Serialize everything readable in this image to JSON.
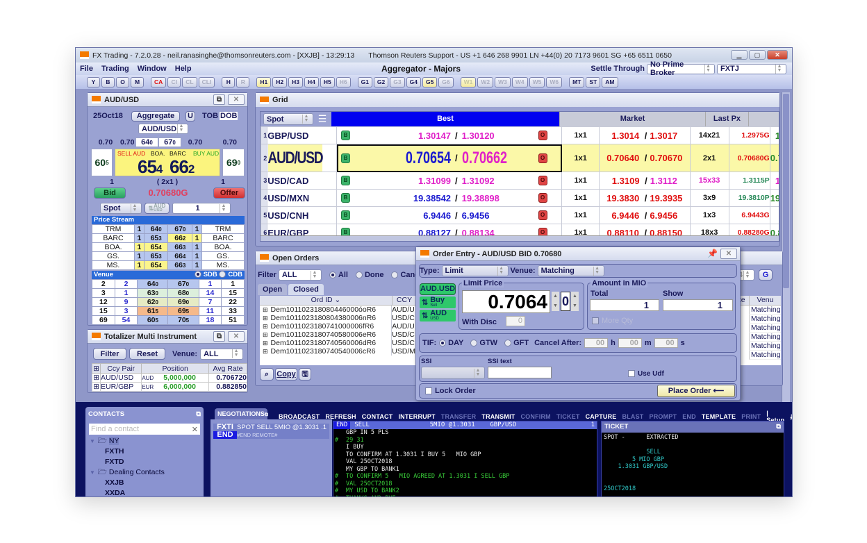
{
  "window": {
    "title": "FX Trading - 7.2.0.28 - neil.ranasinghe@thomsonreuters.com - [XXJB] - 13:29:13",
    "support": "Thomson Reuters Support - US +1 646 268 9901   LN +44(0) 20 7173 9601   SG +65 6511 0650",
    "app_title": "Aggregator - Majors"
  },
  "menu": [
    "File",
    "Trading",
    "Window",
    "Help"
  ],
  "settle": {
    "label": "Settle Through",
    "broker": "No Prime Broker",
    "account": "FXTJ"
  },
  "toolbar": [
    {
      "label": "Y",
      "state": ""
    },
    {
      "label": "B",
      "state": ""
    },
    {
      "label": "O",
      "state": ""
    },
    {
      "label": "M",
      "state": ""
    },
    {
      "sep": true
    },
    {
      "label": "CA",
      "state": "red"
    },
    {
      "label": "CI",
      "state": "dis"
    },
    {
      "label": "CL",
      "state": "dis"
    },
    {
      "label": "CLI",
      "state": "dis"
    },
    {
      "sep": true
    },
    {
      "label": "H",
      "state": ""
    },
    {
      "label": "R",
      "state": "dis"
    },
    {
      "sep": true
    },
    {
      "label": "H1",
      "state": "hl"
    },
    {
      "label": "H2",
      "state": ""
    },
    {
      "label": "H3",
      "state": ""
    },
    {
      "label": "H4",
      "state": ""
    },
    {
      "label": "H5",
      "state": ""
    },
    {
      "label": "H6",
      "state": "dis"
    },
    {
      "sep": true
    },
    {
      "label": "G1",
      "state": ""
    },
    {
      "label": "G2",
      "state": ""
    },
    {
      "label": "G3",
      "state": "dis"
    },
    {
      "label": "G4",
      "state": ""
    },
    {
      "label": "G5",
      "state": "hl"
    },
    {
      "label": "G6",
      "state": "dis"
    },
    {
      "sep": true
    },
    {
      "label": "W1",
      "state": "hl dis"
    },
    {
      "label": "W2",
      "state": "dis"
    },
    {
      "label": "W3",
      "state": "dis"
    },
    {
      "label": "W4",
      "state": "dis"
    },
    {
      "label": "W5",
      "state": "dis"
    },
    {
      "label": "W6",
      "state": "dis"
    },
    {
      "sep": true
    },
    {
      "label": "MT",
      "state": ""
    },
    {
      "label": "ST",
      "state": ""
    },
    {
      "label": "AM",
      "state": ""
    }
  ],
  "tile": {
    "title": "AUD/USD",
    "date": "25Oct18",
    "mode": "Aggregate",
    "u": "U",
    "tob": "TOB",
    "dob": "DOB",
    "pair": "AUD/USD",
    "big_l": "0.70",
    "big_l2": "0.70",
    "bid_top": "64",
    "bid_top_s": "0",
    "ask_top": "67",
    "ask_top_s": "0",
    "big_r": "0.70",
    "big_r2": "0.70",
    "side_bid": "60",
    "side_bid_s": "5",
    "side_ask": "69",
    "side_ask_s": "0",
    "sell_label": "SELL AUD",
    "sell_venue": "BOA.",
    "buy_venue": "BARC",
    "buy_label": "BUY AUD",
    "bid_big": "65",
    "bid_pip": "4",
    "ask_big": "66",
    "ask_pip": "2",
    "bid_qty": "1",
    "ratio": "( 2x1 )",
    "ask_qty": "1",
    "bid_btn": "Bid",
    "last": "0.70680G",
    "offer_btn": "Offer",
    "tenor": "Spot",
    "ccy_top": "AUD",
    "ccy_bot": "USD",
    "amount": "1",
    "stream_title": "Price Stream",
    "stream": [
      {
        "lv": "TRM",
        "bq": "1",
        "b": "64",
        "bs": "0",
        "a": "67",
        "as": "0",
        "aq": "1",
        "rv": "TRM",
        "bh": "",
        "ah": ""
      },
      {
        "lv": "BARC",
        "bq": "1",
        "b": "65",
        "bs": "3",
        "a": "66",
        "as": "2",
        "aq": "1",
        "rv": "BARC",
        "bh": "",
        "ah": "yl"
      },
      {
        "lv": "BOA.",
        "bq": "1",
        "b": "65",
        "bs": "4",
        "a": "66",
        "as": "3",
        "aq": "1",
        "rv": "BOA.",
        "bh": "yl",
        "ah": ""
      },
      {
        "lv": "GS.",
        "bq": "1",
        "b": "65",
        "bs": "3",
        "a": "66",
        "as": "4",
        "aq": "1",
        "rv": "GS.",
        "bh": "",
        "ah": ""
      },
      {
        "lv": "MS.",
        "bq": "1",
        "b": "65",
        "bs": "4",
        "a": "66",
        "as": "3",
        "aq": "1",
        "rv": "MS.",
        "bh": "yl",
        "ah": ""
      }
    ],
    "venue_title": "Venue",
    "sdb": "SDB",
    "cdb": "CDB",
    "venue": [
      {
        "c1": "2",
        "c2": "2",
        "b": "64",
        "bs": "0",
        "a": "67",
        "as": "0",
        "c5": "1",
        "c6": "1",
        "bg": "#b6c6ee",
        "ag": "#b6c6ee"
      },
      {
        "c1": "3",
        "c2": "1",
        "b": "63",
        "bs": "0",
        "a": "68",
        "as": "0",
        "c5": "14",
        "c6": "15",
        "bg": "#dcefdc",
        "ag": "#dcefdc"
      },
      {
        "c1": "12",
        "c2": "9",
        "b": "62",
        "bs": "0",
        "a": "69",
        "as": "0",
        "c5": "7",
        "c6": "22",
        "bg": "#e6ebc4",
        "ag": "#e6ebc4"
      },
      {
        "c1": "15",
        "c2": "3",
        "b": "61",
        "bs": "5",
        "a": "69",
        "as": "5",
        "c5": "11",
        "c6": "33",
        "bg": "#f5b98a",
        "ag": "#f5b98a"
      },
      {
        "c1": "69",
        "c2": "54",
        "b": "60",
        "bs": "5",
        "a": "70",
        "as": "5",
        "c5": "18",
        "c6": "51",
        "bg": "#b6c6ee",
        "ag": "#b6c6ee"
      }
    ]
  },
  "totalizer": {
    "title": "Totalizer Multi Instrument",
    "filter": "Filter",
    "reset": "Reset",
    "venue_label": "Venue:",
    "venue": "ALL",
    "headers": [
      "Ccy Pair",
      "Position",
      "Avg Rate"
    ],
    "rows": [
      {
        "pair": "AUD/USD",
        "ccy": "AUD",
        "pos": "5,000,000",
        "rate": "0.706720"
      },
      {
        "pair": "EUR/GBP",
        "ccy": "EUR",
        "pos": "6,000,000",
        "rate": "0.882850"
      }
    ]
  },
  "grid": {
    "title": "Grid",
    "tenor": "Spot",
    "h_best": "Best",
    "h_market": "Market",
    "h_last": "Last Px",
    "rows": [
      {
        "n": "1",
        "pair": "GBP/USD",
        "bb": "1.30147",
        "bbc": "#e020c8",
        "ba": "1.30120",
        "bac": "#e020c8",
        "sz": "1x1",
        "mb": "1.3014",
        "mbc": "#e01010",
        "ma": "1.3017",
        "mac": "#e01010",
        "msz": "14x21",
        "mszc": "#111",
        "last": "1.2975G",
        "lastc": "#e01010",
        "ex": "1.3",
        "exc": "#2a8a2a"
      },
      {
        "n": "2",
        "pair": "AUD/USD",
        "bb": "0.70654",
        "bbc": "#1a1ad0",
        "ba": "0.70662",
        "bac": "#e020c8",
        "sz": "1x1",
        "mb": "0.70640",
        "mbc": "#e01010",
        "ma": "0.70670",
        "mac": "#e01010",
        "msz": "2x1",
        "mszc": "#111",
        "last": "0.70680G",
        "lastc": "#e01010",
        "ex": "0.70",
        "exc": "#2a8a2a",
        "sel": true
      },
      {
        "n": "3",
        "pair": "USD/CAD",
        "bb": "1.31099",
        "bbc": "#e020c8",
        "ba": "1.31092",
        "bac": "#e020c8",
        "sz": "1x1",
        "mb": "1.3109",
        "mbc": "#e01010",
        "ma": "1.3112",
        "mac": "#e020c8",
        "msz": "15x33",
        "mszc": "#e020c8",
        "last": "1.3115P",
        "lastc": "#2a8a5a",
        "ex": "1.3",
        "exc": "#e020c8"
      },
      {
        "n": "4",
        "pair": "USD/MXN",
        "bb": "19.38542",
        "bbc": "#1a1ad0",
        "ba": "19.38898",
        "bac": "#e020c8",
        "sz": "1x1",
        "mb": "19.3830",
        "mbc": "#e01010",
        "ma": "19.3935",
        "mac": "#e01010",
        "msz": "3x9",
        "mszc": "#111",
        "last": "19.3810P",
        "lastc": "#2a8a5a",
        "ex": "19.3",
        "exc": "#2a8a2a"
      },
      {
        "n": "5",
        "pair": "USD/CNH",
        "bb": "6.9446",
        "bbc": "#1a1ad0",
        "ba": "6.9456",
        "bac": "#1a1ad0",
        "sz": "1x1",
        "mb": "6.9446",
        "mbc": "#e01010",
        "ma": "6.9456",
        "mac": "#e01010",
        "msz": "1x3",
        "mszc": "#111",
        "last": "6.9443G",
        "lastc": "#e01010",
        "ex": "",
        "exc": "#2a8a2a"
      },
      {
        "n": "6",
        "pair": "EUR/GBP",
        "bb": "0.88127",
        "bbc": "#1a1ad0",
        "ba": "0.88134",
        "bac": "#e020c8",
        "sz": "1x1",
        "mb": "0.88110",
        "mbc": "#e01010",
        "ma": "0.88150",
        "mac": "#e01010",
        "msz": "18x3",
        "mszc": "#111",
        "last": "0.88280G",
        "lastc": "#e01010",
        "ex": "0.88",
        "exc": "#2a8a2a"
      }
    ]
  },
  "orders": {
    "title": "Open Orders",
    "filter_label": "Filter",
    "filter": "ALL",
    "r_all": "All",
    "r_done": "Done",
    "r_canc": "Canc",
    "tab_open": "Open",
    "tab_closed": "Closed",
    "h_id": "Ord ID",
    "h_ccy": "CCY",
    "h_rate": "ate",
    "h_venue": "Venu",
    "page": "4",
    "go": "G",
    "rows": [
      {
        "id": "Dem101102318080446000óoR6",
        "ccy": "AUD/U"
      },
      {
        "id": "Dem1011023180804380006nR6",
        "ccy": "USD/C"
      },
      {
        "id": "Dem1011023180741000006fR6",
        "ccy": "AUD/U"
      },
      {
        "id": "Dem1011023180740580006eR6",
        "ccy": "USD/C"
      },
      {
        "id": "Dem1011023180740560006dR6",
        "ccy": "USD/C"
      },
      {
        "id": "Dem1011023180740540006cR6",
        "ccy": "USD/M"
      }
    ],
    "venue_val": "Matching",
    "copy": "Copy"
  },
  "order_entry": {
    "title": "Order Entry - AUD/USD  BID 0.70680",
    "type_label": "Type:",
    "type": "Limit",
    "venue_label": "Venue:",
    "venue": "Matching",
    "pair": "AUD.USD",
    "side_top": "Buy",
    "side_bot": "Sell",
    "ccy_top": "AUD",
    "ccy_bot": "USD",
    "limit_label": "Limit Price",
    "price": "0.7064",
    "pip": "0",
    "disc_label": "With Disc",
    "disc": "0",
    "amount_label": "Amount in MIO",
    "total_label": "Total",
    "total": "1",
    "show_label": "Show",
    "show": "1",
    "more_qty": "More Qty",
    "tif_label": "TIF:",
    "tif": [
      "DAY",
      "GTW",
      "GFT"
    ],
    "cancel_after": "Cancel After:",
    "h": "00",
    "m": "00",
    "s": "00",
    "hl": "h",
    "ml": "m",
    "sl": "s",
    "ssi_label": "SSI",
    "ssi_text_label": "SSI text",
    "use_udf": "Use Udf",
    "lock": "Lock Order",
    "place": "Place Order"
  },
  "contacts": {
    "title": "CONTACTS",
    "placeholder": "Find a contact",
    "tree": [
      {
        "label": "NY",
        "level": 0,
        "folder": true,
        "sel": true
      },
      {
        "label": "FXTH",
        "level": 1
      },
      {
        "label": "FXTD",
        "level": 1
      },
      {
        "label": "Dealing Contacts",
        "level": 0,
        "folder": true
      },
      {
        "label": "XXJB",
        "level": 1
      },
      {
        "label": "XXDA",
        "level": 1
      }
    ]
  },
  "neg": {
    "tab": "NEGOTIATIONS",
    "actions": [
      {
        "l": "BROADCAST",
        "d": false
      },
      {
        "l": "REFRESH",
        "d": false
      },
      {
        "l": "CONTACT",
        "d": false
      },
      {
        "l": "INTERRUPT",
        "d": false
      },
      {
        "l": "TRANSFER",
        "d": true
      },
      {
        "l": "TRANSMIT",
        "d": false
      },
      {
        "l": "CONFIRM",
        "d": true
      },
      {
        "l": "TICKET",
        "d": true
      },
      {
        "l": "CAPTURE",
        "d": false
      },
      {
        "l": "BLAST",
        "d": true
      },
      {
        "l": "PROMPT",
        "d": true
      },
      {
        "l": "END",
        "d": true
      },
      {
        "l": "TEMPLATE",
        "d": false
      },
      {
        "l": "PRINT",
        "d": true
      }
    ],
    "setup": "| Setup",
    "conv_tag": "FXTI",
    "conv_text": "SPOT SELL 5MIO @1.3031 .1",
    "conv_status": "END",
    "conv_sub": "#END REMOTE#",
    "chat_head_tag": "END",
    "chat_head": "SELL                5MIO @1.3031    GBP/USD",
    "chat_count": "1",
    "chat": [
      {
        "p": " ",
        "t": "GBP IN 5 PLS",
        "g": false
      },
      {
        "p": "#",
        "t": "29 31",
        "g": true
      },
      {
        "p": " ",
        "t": "I BUY",
        "g": false
      },
      {
        "p": " ",
        "t": "TO CONFIRM AT 1.3031 I BUY 5   MIO GBP",
        "g": false
      },
      {
        "p": " ",
        "t": "VAL 25OCT2018",
        "g": false
      },
      {
        "p": " ",
        "t": "MY GBP TO BANK1",
        "g": false
      },
      {
        "p": "#",
        "t": "TO CONFIRM 5   MIO AGREED AT 1.3031 I SELL GBP",
        "g": true
      },
      {
        "p": "#",
        "t": "VAL 25OCT2018",
        "g": true
      },
      {
        "p": "#",
        "t": "MY USD TO BANK2",
        "g": true
      },
      {
        "p": "#",
        "t": "THANKS AND BYE",
        "g": true
      }
    ]
  },
  "ticket": {
    "title": "TICKET",
    "lines": [
      "SPOT -      EXTRACTED",
      "",
      "            SELL",
      "        5 MIO GBP",
      "    1.3031 GBP/USD",
      "",
      "",
      "25OCT2018"
    ]
  }
}
